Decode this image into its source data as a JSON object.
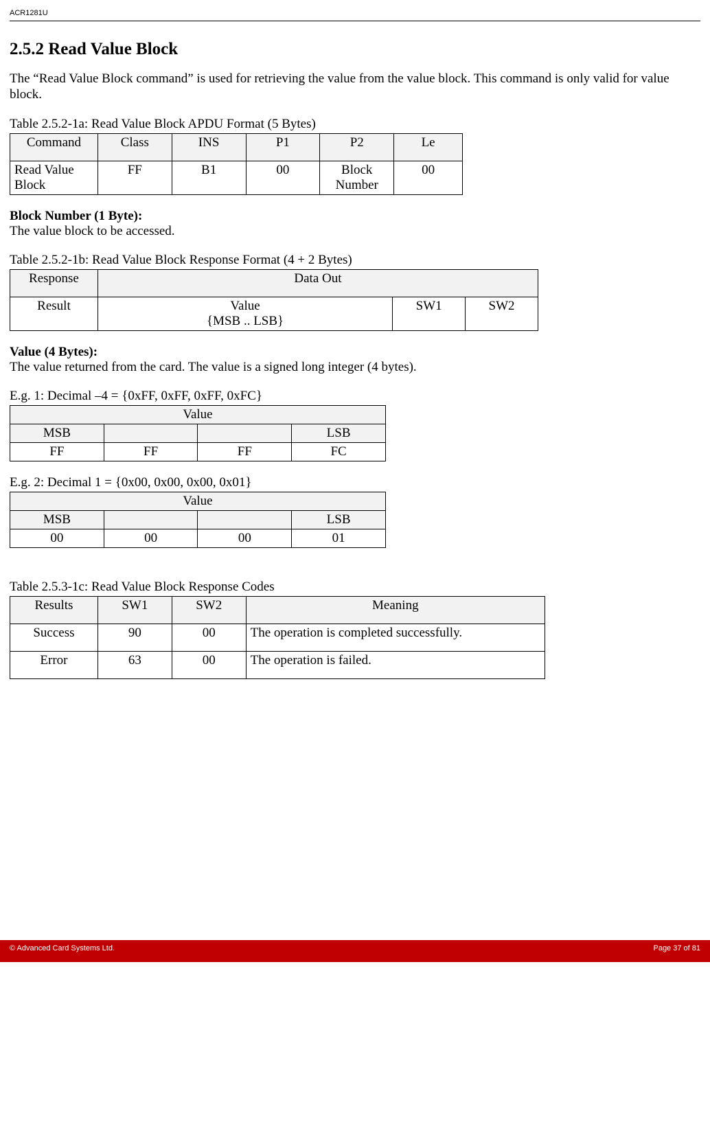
{
  "header": {
    "product": "ACR1281U"
  },
  "section": {
    "number": "2.5.2",
    "title": "Read Value Block",
    "intro": "The “Read Value Block command” is used for retrieving the value from the value block. This command is only valid for value block."
  },
  "table1": {
    "caption": "Table 2.5.2-1a: Read Value Block APDU Format (5 Bytes)",
    "headers": [
      "Command",
      "Class",
      "INS",
      "P1",
      "P2",
      "Le"
    ],
    "row": [
      "Read Value Block",
      "FF",
      "B1",
      "00",
      "Block Number",
      "00"
    ]
  },
  "block_number": {
    "label": "Block Number (1 Byte):",
    "desc": "The value block to be accessed."
  },
  "table2": {
    "caption": "Table 2.5.2-1b: Read Value Block Response Format (4 + 2 Bytes)",
    "header_left": "Response",
    "header_right": "Data Out",
    "row_left": "Result",
    "row_mid_line1": "Value",
    "row_mid_line2": "{MSB .. LSB}",
    "row_c3": "SW1",
    "row_c4": "SW2"
  },
  "value_section": {
    "label": "Value (4 Bytes):",
    "desc": "The value returned from the card. The value is a signed long integer (4 bytes)."
  },
  "example1": {
    "caption": "E.g. 1: Decimal  –4 = {0xFF, 0xFF, 0xFF, 0xFC}",
    "header": "Value",
    "msb": "MSB",
    "lsb": "LSB",
    "values": [
      "FF",
      "FF",
      "FF",
      "FC"
    ]
  },
  "example2": {
    "caption": "E.g. 2: Decimal 1 = {0x00, 0x00, 0x00, 0x01}",
    "header": "Value",
    "msb": "MSB",
    "lsb": "LSB",
    "values": [
      "00",
      "00",
      "00",
      "01"
    ]
  },
  "table3": {
    "caption": "Table 2.5.3-1c: Read Value Block Response Codes",
    "headers": [
      "Results",
      "SW1",
      "SW2",
      "Meaning"
    ],
    "rows": [
      [
        "Success",
        "90",
        "00",
        "The operation is completed successfully."
      ],
      [
        "Error",
        "63",
        "00",
        "The operation is failed."
      ]
    ]
  },
  "footer": {
    "copyright": "© Advanced Card Systems Ltd.",
    "page": "Page 37 of 81"
  }
}
